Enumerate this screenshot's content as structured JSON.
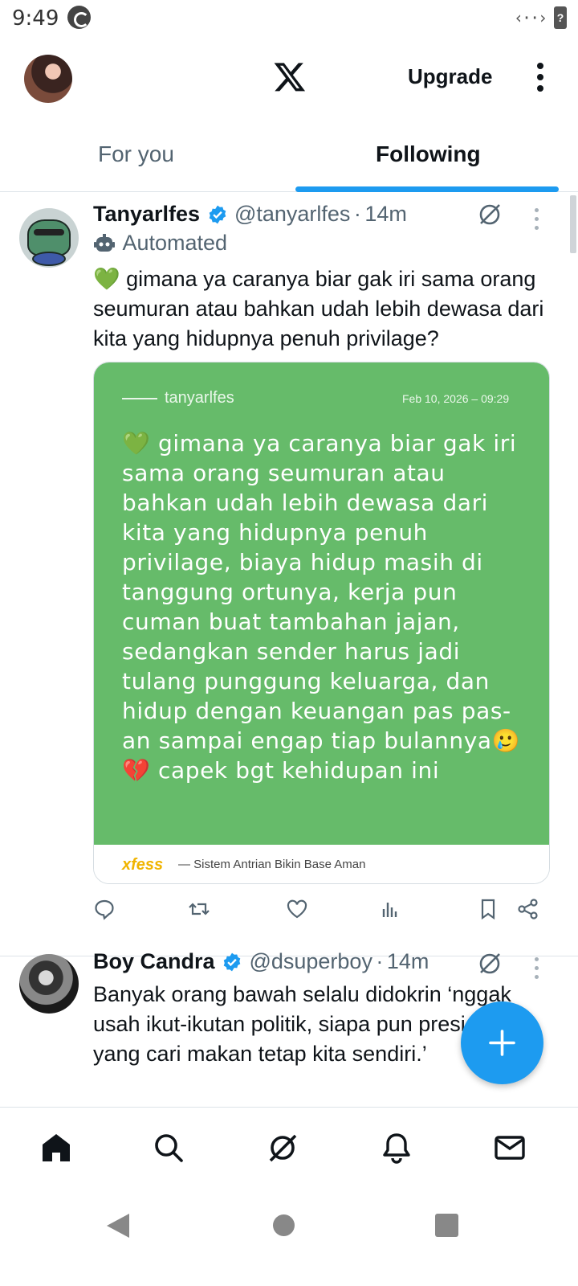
{
  "status_bar": {
    "time": "9:49",
    "signal": "‹··›",
    "battery": "?"
  },
  "top_bar": {
    "upgrade_label": "Upgrade"
  },
  "tabs": [
    {
      "label": "For you",
      "active": false
    },
    {
      "label": "Following",
      "active": true
    }
  ],
  "colors": {
    "accent": "#1d9bf0",
    "card_green": "#66bb6a",
    "brand_yellow": "#f0b400",
    "secondary_text": "#536471"
  },
  "tweets": [
    {
      "name": "Tanyarlfes",
      "handle": "@tanyarlfes",
      "dot": "·",
      "time": "14m",
      "automated_label": "Automated",
      "text": "💚 gimana ya caranya biar gak iri sama orang seumuran atau bahkan udah lebih dewasa dari kita yang hidupnya penuh privilage?",
      "media": {
        "user": "tanyarlfes",
        "date": "Feb 10, 2026 – 09:29",
        "text": "💚 gimana ya caranya biar gak iri sama orang seumuran atau bahkan udah lebih dewasa dari kita yang hidupnya penuh privilage, biaya hidup masih di tanggung ortunya, kerja pun cuman buat tambahan jajan, sedangkan sender harus jadi tulang punggung keluarga, dan hidup dengan keuangan pas pas-an sampai engap tiap bulannya🥲💔 capek bgt kehidupan ini",
        "brand": "xfess",
        "tagline": "— Sistem Antrian Bikin Base Aman"
      }
    },
    {
      "name": "Boy Candra",
      "handle": "@dsuperboy",
      "dot": "·",
      "time": "14m",
      "text": "Banyak orang bawah selalu didokrin ‘nggak usah ikut-ikutan politik, siapa pun presidennya yang cari makan tetap kita sendiri.’"
    }
  ],
  "icons": {
    "top": [
      "avatar",
      "x-logo-icon",
      "more-vertical-icon"
    ],
    "actions": [
      "reply-icon",
      "retweet-icon",
      "like-icon",
      "views-icon",
      "bookmark-icon",
      "share-icon"
    ],
    "bottom_nav": [
      "home-icon",
      "search-icon",
      "grok-icon",
      "notifications-icon",
      "messages-icon"
    ],
    "system": [
      "back-icon",
      "home-button-icon",
      "recents-icon"
    ]
  }
}
